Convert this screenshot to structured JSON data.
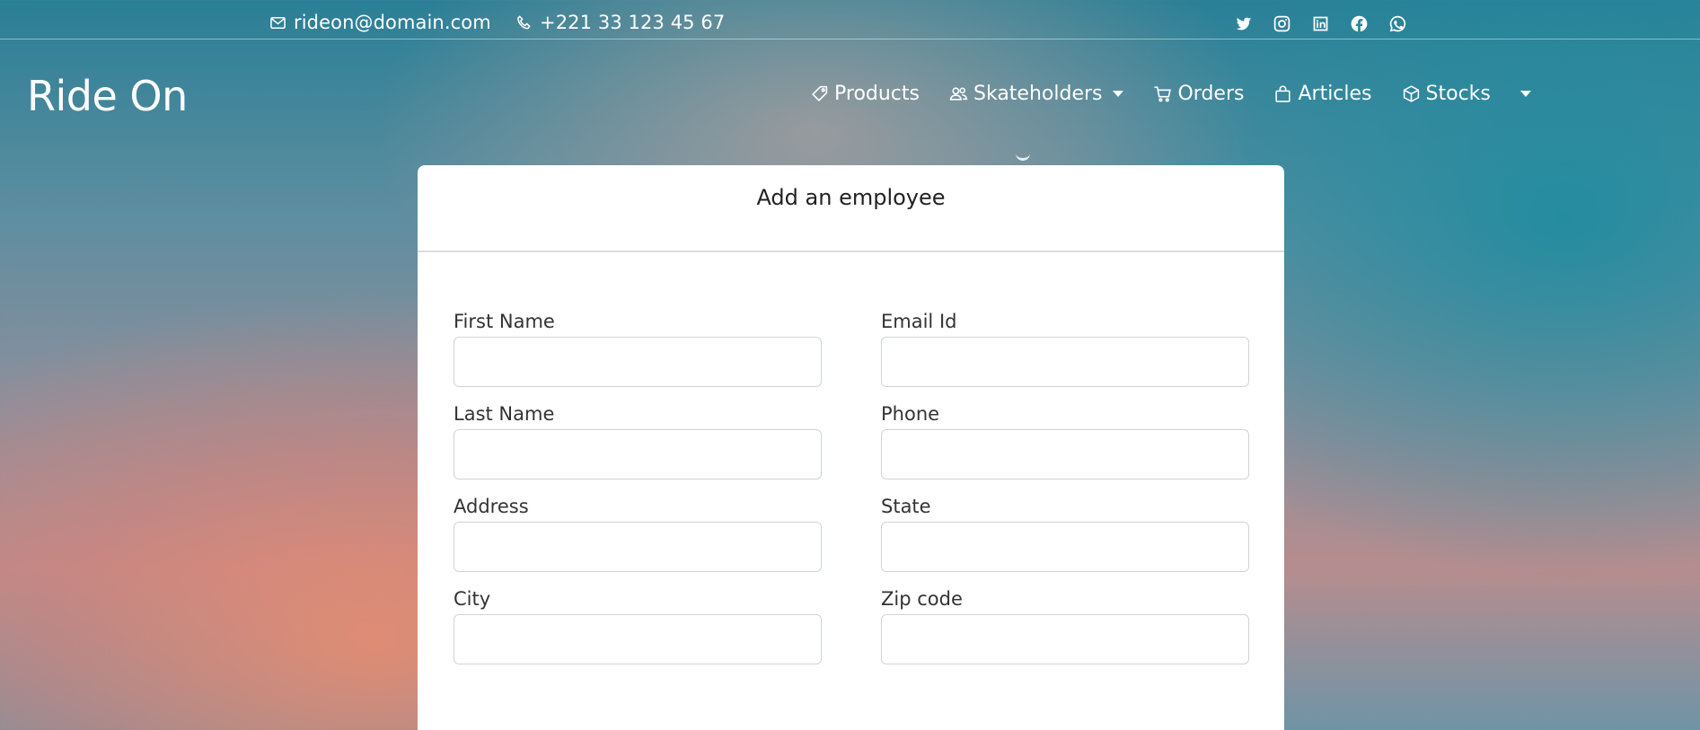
{
  "topbar": {
    "email": "rideon@domain.com",
    "phone": "+221 33 123 45 67",
    "social_icons": [
      "twitter-icon",
      "instagram-icon",
      "linkedin-icon",
      "facebook-icon",
      "whatsapp-icon"
    ]
  },
  "brand": {
    "name": "Ride On"
  },
  "nav": {
    "items": [
      {
        "label": "Products",
        "icon": "tag-icon"
      },
      {
        "label": "Skateholders",
        "icon": "users-icon",
        "dropdown": true
      },
      {
        "label": "Orders",
        "icon": "cart-icon"
      },
      {
        "label": "Articles",
        "icon": "bag-icon"
      },
      {
        "label": "Stocks",
        "icon": "box-icon"
      }
    ]
  },
  "form": {
    "title": "Add an employee",
    "fields": {
      "first_name": {
        "label": "First Name",
        "value": ""
      },
      "email": {
        "label": "Email Id",
        "value": ""
      },
      "last_name": {
        "label": "Last Name",
        "value": ""
      },
      "phone": {
        "label": "Phone",
        "value": ""
      },
      "address": {
        "label": "Address",
        "value": ""
      },
      "state": {
        "label": "State",
        "value": ""
      },
      "city": {
        "label": "City",
        "value": ""
      },
      "zip": {
        "label": "Zip code",
        "value": ""
      }
    }
  },
  "colors": {
    "text_on_bg": "#ffffff",
    "card_bg": "#ffffff",
    "input_border": "#cfd4da"
  }
}
